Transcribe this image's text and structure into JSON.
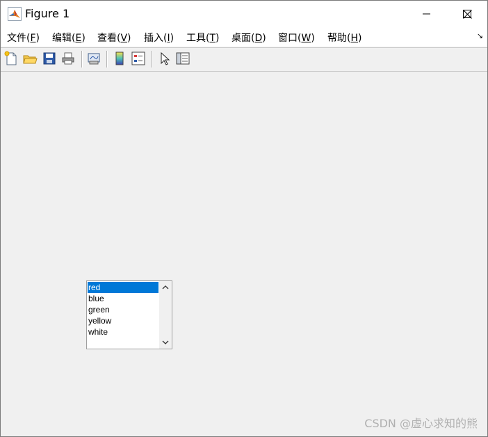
{
  "window": {
    "title": "Figure 1"
  },
  "window_buttons": {
    "minimize": "minimize-icon",
    "maximize": "maximize-icon",
    "close": "close-icon"
  },
  "menubar": {
    "items": [
      {
        "label": "文件(",
        "key": "F",
        "tail": ")"
      },
      {
        "label": "编辑(",
        "key": "E",
        "tail": ")"
      },
      {
        "label": "查看(",
        "key": "V",
        "tail": ")"
      },
      {
        "label": "插入(",
        "key": "I",
        "tail": ")"
      },
      {
        "label": "工具(",
        "key": "T",
        "tail": ")"
      },
      {
        "label": "桌面(",
        "key": "D",
        "tail": ")"
      },
      {
        "label": "窗口(",
        "key": "W",
        "tail": ")"
      },
      {
        "label": "帮助(",
        "key": "H",
        "tail": ")"
      }
    ],
    "overflow_arrow": "↘"
  },
  "toolbar": {
    "tools": [
      "new-figure-icon",
      "open-file-icon",
      "save-icon",
      "print-icon",
      "link-plot-icon",
      "colorbar-icon",
      "legend-icon",
      "pointer-icon",
      "property-editor-icon"
    ]
  },
  "listbox": {
    "items": [
      "red",
      "blue",
      "green",
      "yellow",
      "white"
    ],
    "selected_index": 0
  },
  "watermark": "CSDN @虚心求知的熊"
}
